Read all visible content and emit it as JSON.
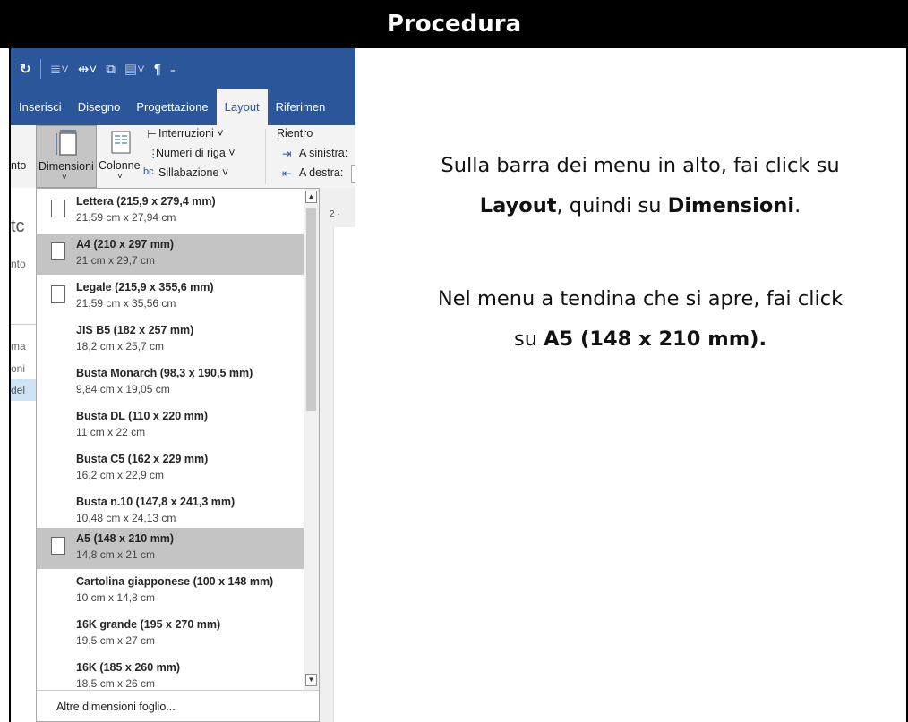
{
  "header": {
    "title": "Procedura"
  },
  "ribbon": {
    "tabs": [
      "Inserisci",
      "Disegno",
      "Progettazione",
      "Layout",
      "Riferimen"
    ],
    "orient_label": "nto",
    "dimensioni_label": "Dimensioni",
    "colonne_label": "Colonne",
    "interruzioni": "Interruzioni ˅",
    "numeri_riga": "Numeri di riga ˅",
    "sillabazione": "Sillabazione ˅",
    "rientro": "Rientro",
    "a_sinistra": "A sinistra:",
    "a_destra": "A destra:"
  },
  "doc_left": {
    "t1": "tc",
    "t2": "nto",
    "t3": "ma",
    "t4": "oni",
    "t5": "del"
  },
  "ruler": "2 ·",
  "menu": {
    "items": [
      {
        "name": "Lettera (215,9 x 279,4 mm)",
        "size": "21,59 cm x 27,94 cm"
      },
      {
        "name": "A4 (210 x 297 mm)",
        "size": "21 cm x 29,7 cm"
      },
      {
        "name": "Legale (215,9 x 355,6 mm)",
        "size": "21,59 cm x 35,56 cm"
      },
      {
        "name": "JIS B5 (182 x 257 mm)",
        "size": "18,2 cm x 25,7 cm"
      },
      {
        "name": "Busta Monarch (98,3 x 190,5 mm)",
        "size": "9,84 cm x 19,05 cm"
      },
      {
        "name": "Busta DL (110 x 220 mm)",
        "size": "11 cm x 22 cm"
      },
      {
        "name": "Busta C5 (162 x 229 mm)",
        "size": "16,2 cm x 22,9 cm"
      },
      {
        "name": "Busta n.10 (147,8 x 241,3 mm)",
        "size": "10,48 cm x 24,13 cm"
      },
      {
        "name": "A5 (148 x 210 mm)",
        "size": "14,8 cm x 21 cm"
      },
      {
        "name": "Cartolina giapponese (100 x 148 mm)",
        "size": "10 cm x 14,8 cm"
      },
      {
        "name": "16K grande (195 x 270 mm)",
        "size": "19,5 cm x 27 cm"
      },
      {
        "name": "16K (185 x 260 mm)",
        "size": "18,5 cm x 26 cm"
      }
    ],
    "more": "Altre dimensioni foglio..."
  },
  "instructions": {
    "p1_pre": "Sulla barra dei menu in alto, fai click su",
    "p1_b1": "Layout",
    "p1_mid": ", quindi su ",
    "p1_b2": "Dimensioni",
    "p1_end": ".",
    "p2_pre": "Nel menu a tendina che si apre, fai click",
    "p2_su": "su ",
    "p2_b": "A5 (148 x 210 mm)."
  }
}
